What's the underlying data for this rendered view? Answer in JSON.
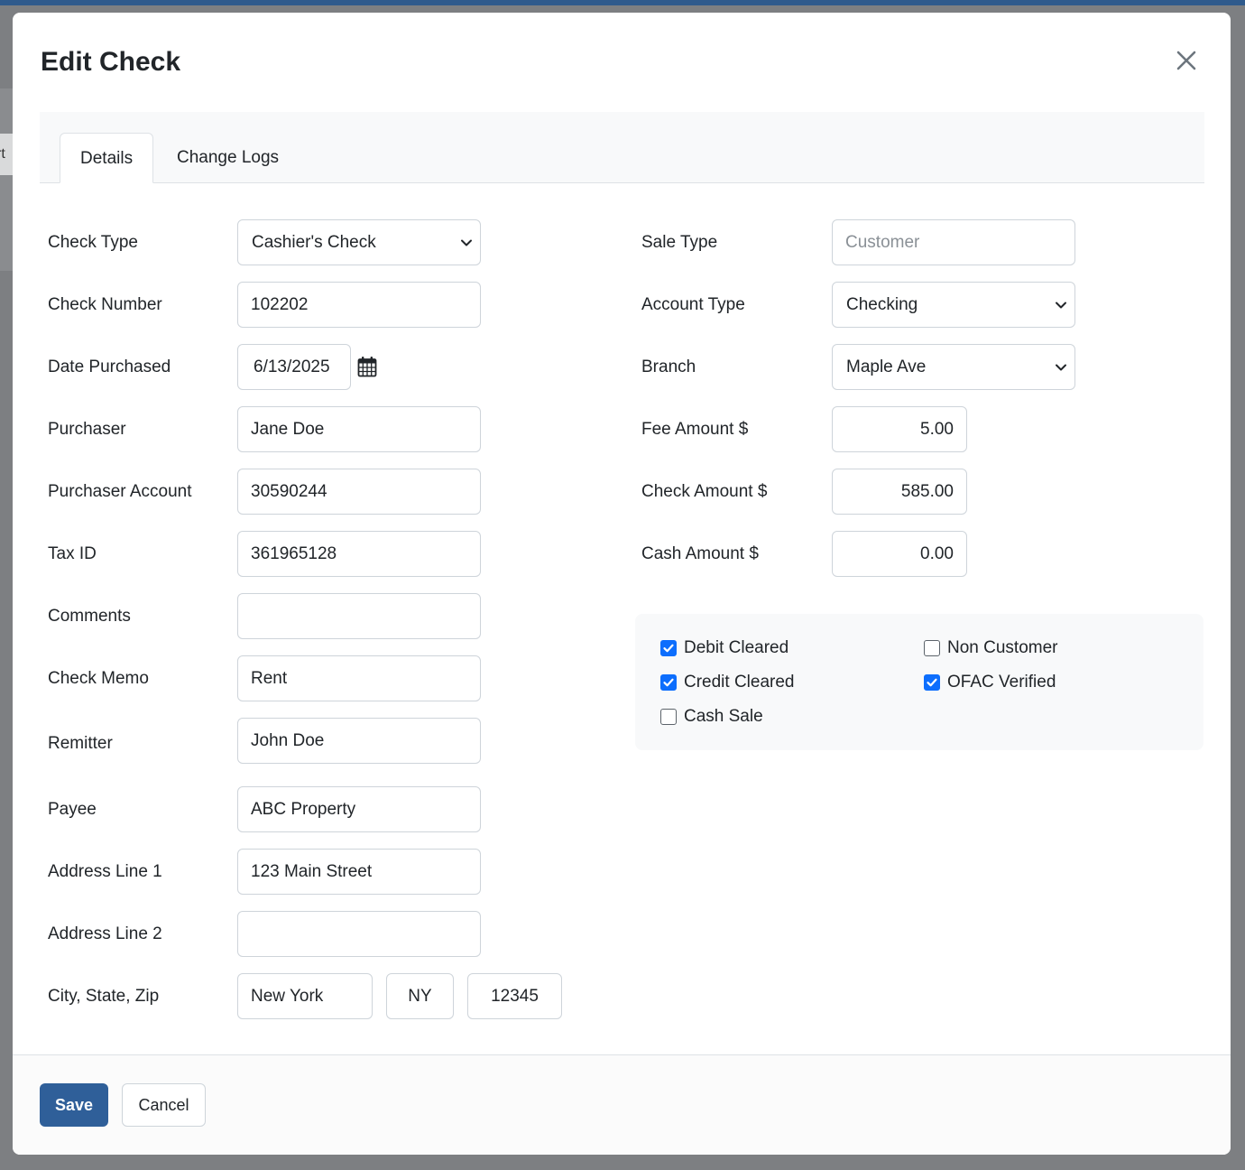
{
  "background": {
    "tab_fragment": "rt"
  },
  "modal": {
    "title": "Edit Check",
    "close_icon": "close-icon"
  },
  "tabs": [
    {
      "label": "Details",
      "active": true
    },
    {
      "label": "Change Logs",
      "active": false
    }
  ],
  "left_form": {
    "check_type": {
      "label": "Check Type",
      "value": "Cashier's Check"
    },
    "check_number": {
      "label": "Check Number",
      "value": "102202"
    },
    "date_purchased": {
      "label": "Date Purchased",
      "value": "6/13/2025",
      "icon": "calendar-icon"
    },
    "purchaser": {
      "label": "Purchaser",
      "value": "Jane Doe"
    },
    "purchaser_account": {
      "label": "Purchaser Account",
      "value": "30590244"
    },
    "tax_id": {
      "label": "Tax ID",
      "value": "361965128"
    },
    "comments": {
      "label": "Comments",
      "value": ""
    },
    "check_memo": {
      "label": "Check Memo",
      "value": "Rent"
    },
    "remitter": {
      "label": "Remitter",
      "value": "John Doe"
    },
    "payee": {
      "label": "Payee",
      "value": "ABC Property"
    },
    "address_line_1": {
      "label": "Address Line 1",
      "value": "123 Main Street"
    },
    "address_line_2": {
      "label": "Address Line 2",
      "value": ""
    },
    "city_state_zip": {
      "label": "City, State, Zip",
      "city": "New York",
      "state": "NY",
      "zip": "12345"
    }
  },
  "right_form": {
    "sale_type": {
      "label": "Sale Type",
      "placeholder": "Customer"
    },
    "account_type": {
      "label": "Account Type",
      "value": "Checking"
    },
    "branch": {
      "label": "Branch",
      "value": "Maple Ave"
    },
    "fee_amount": {
      "label": "Fee Amount $",
      "value": "5.00"
    },
    "check_amount": {
      "label": "Check Amount $",
      "value": "585.00"
    },
    "cash_amount": {
      "label": "Cash Amount $",
      "value": "0.00"
    }
  },
  "checkboxes": {
    "debit_cleared": {
      "label": "Debit Cleared",
      "checked": true
    },
    "credit_cleared": {
      "label": "Credit Cleared",
      "checked": true
    },
    "cash_sale": {
      "label": "Cash Sale",
      "checked": false
    },
    "non_customer": {
      "label": "Non Customer",
      "checked": false
    },
    "ofac_verified": {
      "label": "OFAC Verified",
      "checked": true
    }
  },
  "footer": {
    "save_label": "Save",
    "cancel_label": "Cancel"
  },
  "colors": {
    "primary": "#2f5f99",
    "checkbox": "#0d6efd",
    "border": "#ced4da"
  }
}
